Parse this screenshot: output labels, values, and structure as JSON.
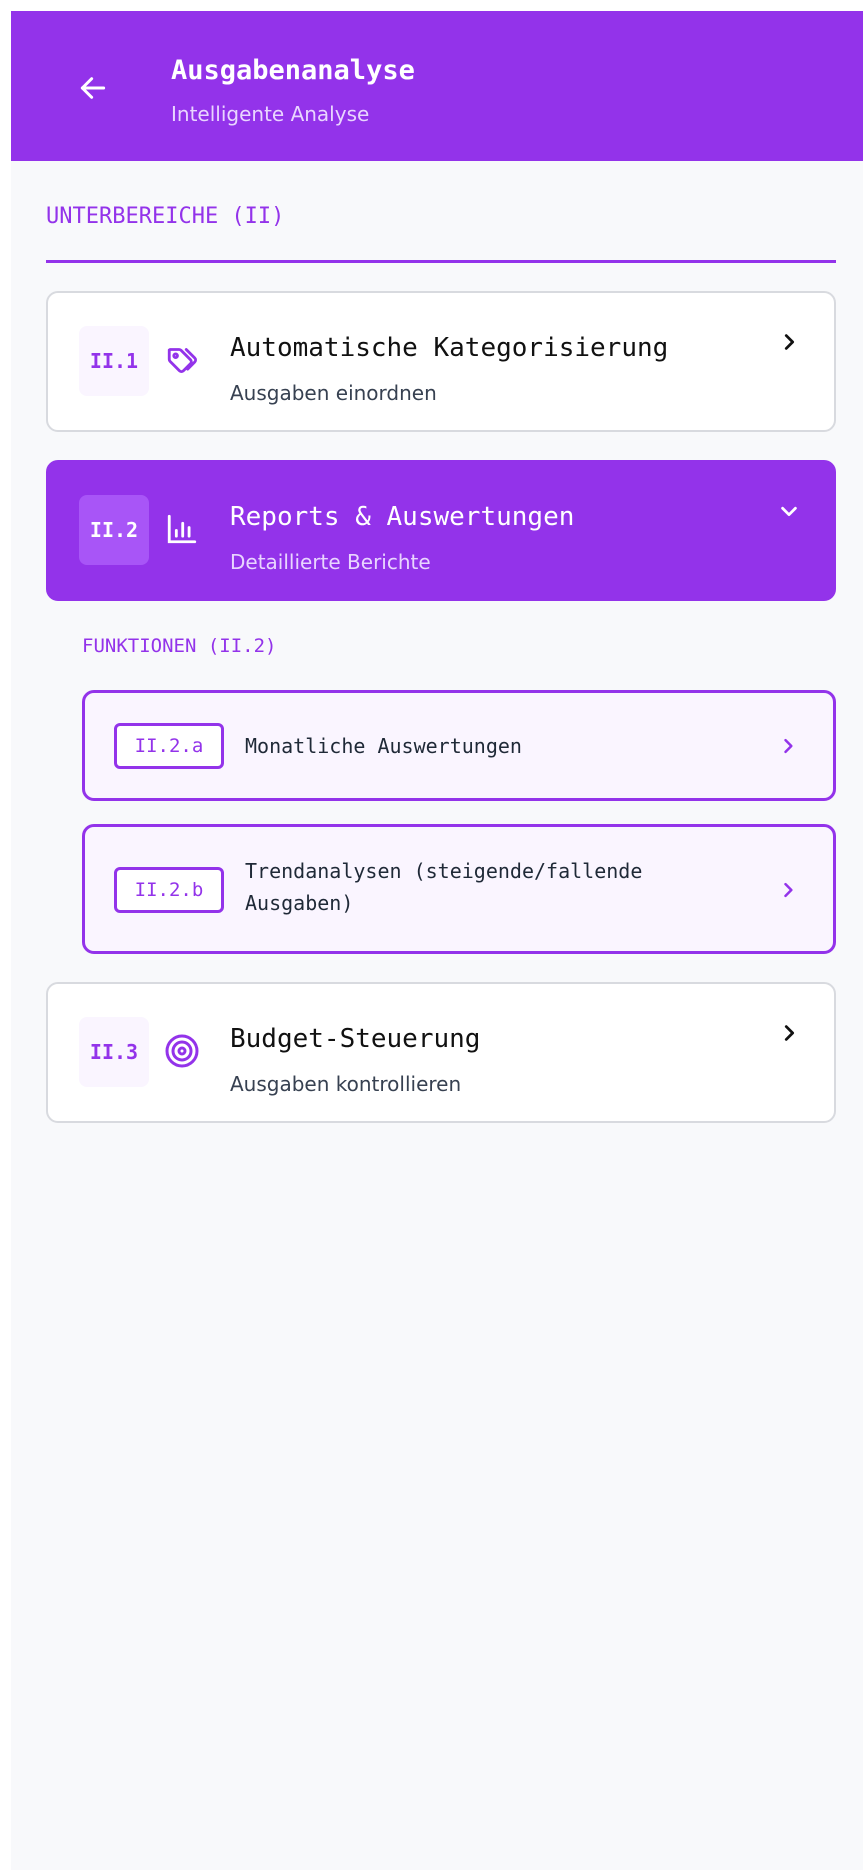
{
  "header": {
    "title": "Ausgabenanalyse",
    "subtitle": "Intelligente Analyse",
    "back_icon": "arrow-left-icon"
  },
  "section": {
    "title": "UNTERBEREICHE (II)"
  },
  "subareas": [
    {
      "code": "II.1",
      "icon": "tags-icon",
      "title": "Automatische Kategorisierung",
      "subtitle": "Ausgaben einordnen",
      "chevron": "chevron-right-icon"
    },
    {
      "code": "II.2",
      "icon": "bar-chart-icon",
      "title": "Reports & Auswertungen",
      "subtitle": "Detaillierte Berichte",
      "chevron": "chevron-down-icon",
      "expanded": true
    },
    {
      "code": "II.3",
      "icon": "target-icon",
      "title": "Budget-Steuerung",
      "subtitle": "Ausgaben kontrollieren",
      "chevron": "chevron-right-icon"
    }
  ],
  "functions": {
    "title": "FUNKTIONEN (II.2)",
    "items": [
      {
        "code": "II.2.a",
        "label": "Monatliche Auswertungen"
      },
      {
        "code": "II.2.b",
        "label_line1": "Trendanalysen (steigende/fallende",
        "label_line2": "Ausgaben)"
      }
    ]
  },
  "colors": {
    "accent": "#9333ea",
    "accent_light": "#e9d5ff",
    "chip_bg": "#faf5ff",
    "background": "#f8f9fb"
  }
}
